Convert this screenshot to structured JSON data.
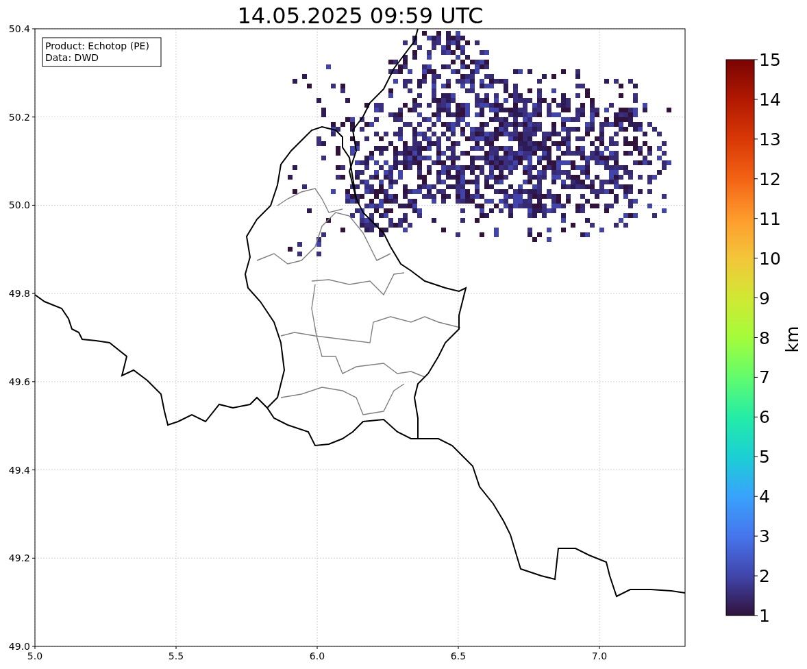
{
  "plot": {
    "title": "14.05.2025 09:59 UTC",
    "info_lines": [
      "Product: Echotop (PE)",
      "Data: DWD"
    ],
    "xticks": [
      "5.0",
      "5.5",
      "6.0",
      "6.5",
      "7.0"
    ],
    "yticks": [
      "50.4",
      "50.2",
      "50.0",
      "49.8",
      "49.6",
      "49.4",
      "49.2",
      "49.0"
    ]
  },
  "colorbar": {
    "label": "km",
    "ticks": [
      "15",
      "14",
      "13",
      "12",
      "11",
      "10",
      "9",
      "8",
      "7",
      "6",
      "5",
      "4",
      "3",
      "2",
      "1"
    ]
  }
}
